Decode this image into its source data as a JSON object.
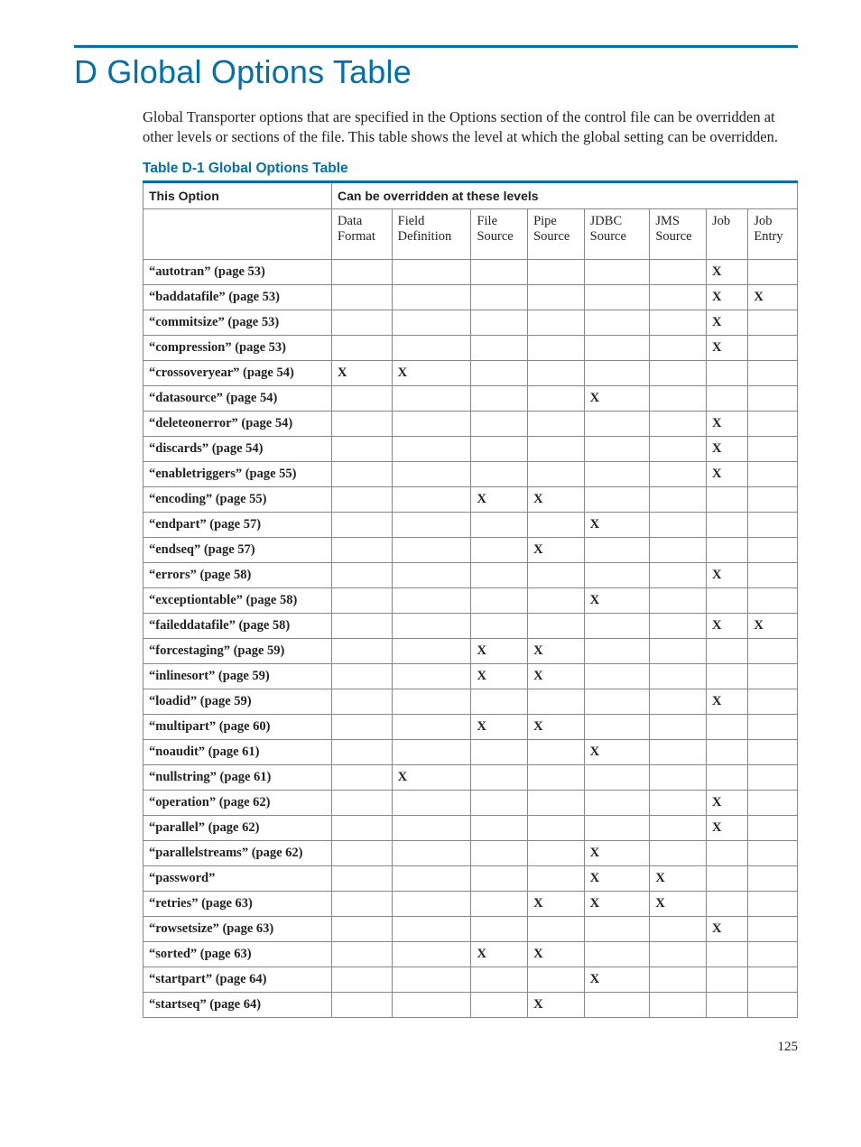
{
  "title": "D Global Options Table",
  "intro": "Global Transporter options that are specified in the Options section of the control file can be overridden at other levels or sections of the file. This table shows the level at which the global setting can be overridden.",
  "caption": "Table D-1 Global Options Table",
  "page_number": "125",
  "mark": "X",
  "header": {
    "this_option": "This Option",
    "override": "Can be overridden at these levels",
    "cols": [
      "Data Format",
      "Field Definition",
      "File Source",
      "Pipe Source",
      "JDBC Source",
      "JMS Source",
      "Job",
      "Job Entry"
    ]
  },
  "rows": [
    {
      "label": "“autotran” (page 53)",
      "marks": [
        "",
        "",
        "",
        "",
        "",
        "",
        "X",
        ""
      ]
    },
    {
      "label": "“baddatafile” (page 53)",
      "marks": [
        "",
        "",
        "",
        "",
        "",
        "",
        "X",
        "X"
      ]
    },
    {
      "label": "“commitsize” (page 53)",
      "marks": [
        "",
        "",
        "",
        "",
        "",
        "",
        "X",
        ""
      ]
    },
    {
      "label": "“compression” (page 53)",
      "marks": [
        "",
        "",
        "",
        "",
        "",
        "",
        "X",
        ""
      ]
    },
    {
      "label": "“crossoveryear” (page 54)",
      "marks": [
        "X",
        "X",
        "",
        "",
        "",
        "",
        "",
        ""
      ]
    },
    {
      "label": "“datasource” (page 54)",
      "marks": [
        "",
        "",
        "",
        "",
        "X",
        "",
        "",
        ""
      ]
    },
    {
      "label": "“deleteonerror” (page 54)",
      "marks": [
        "",
        "",
        "",
        "",
        "",
        "",
        "X",
        ""
      ]
    },
    {
      "label": "“discards” (page 54)",
      "marks": [
        "",
        "",
        "",
        "",
        "",
        "",
        "X",
        ""
      ]
    },
    {
      "label": "“enabletriggers” (page 55)",
      "marks": [
        "",
        "",
        "",
        "",
        "",
        "",
        "X",
        ""
      ]
    },
    {
      "label": "“encoding” (page 55)",
      "marks": [
        "",
        "",
        "X",
        "X",
        "",
        "",
        "",
        ""
      ]
    },
    {
      "label": "“endpart” (page 57)",
      "marks": [
        "",
        "",
        "",
        "",
        "X",
        "",
        "",
        ""
      ]
    },
    {
      "label": "“endseq” (page 57)",
      "marks": [
        "",
        "",
        "",
        "X",
        "",
        "",
        "",
        ""
      ]
    },
    {
      "label": "“errors” (page 58)",
      "marks": [
        "",
        "",
        "",
        "",
        "",
        "",
        "X",
        ""
      ]
    },
    {
      "label": "“exceptiontable” (page 58)",
      "marks": [
        "",
        "",
        "",
        "",
        "X",
        "",
        "",
        ""
      ]
    },
    {
      "label": "“faileddatafile” (page 58)",
      "marks": [
        "",
        "",
        "",
        "",
        "",
        "",
        "X",
        "X"
      ]
    },
    {
      "label": "“forcestaging” (page 59)",
      "marks": [
        "",
        "",
        "X",
        "X",
        "",
        "",
        "",
        ""
      ]
    },
    {
      "label": "“inlinesort” (page 59)",
      "marks": [
        "",
        "",
        "X",
        "X",
        "",
        "",
        "",
        ""
      ]
    },
    {
      "label": "“loadid” (page 59)",
      "marks": [
        "",
        "",
        "",
        "",
        "",
        "",
        "X",
        ""
      ]
    },
    {
      "label": "“multipart” (page 60)",
      "marks": [
        "",
        "",
        "X",
        "X",
        "",
        "",
        "",
        ""
      ]
    },
    {
      "label": "“noaudit” (page 61)",
      "marks": [
        "",
        "",
        "",
        "",
        "X",
        "",
        "",
        ""
      ]
    },
    {
      "label": "“nullstring” (page 61)",
      "marks": [
        "",
        "X",
        "",
        "",
        "",
        "",
        "",
        ""
      ]
    },
    {
      "label": "“operation” (page 62)",
      "marks": [
        "",
        "",
        "",
        "",
        "",
        "",
        "X",
        ""
      ]
    },
    {
      "label": "“parallel” (page 62)",
      "marks": [
        "",
        "",
        "",
        "",
        "",
        "",
        "X",
        ""
      ]
    },
    {
      "label": "“parallelstreams” (page 62)",
      "marks": [
        "",
        "",
        "",
        "",
        "X",
        "",
        "",
        ""
      ]
    },
    {
      "label": "“password”",
      "marks": [
        "",
        "",
        "",
        "",
        "X",
        "X",
        "",
        ""
      ]
    },
    {
      "label": "“retries” (page 63)",
      "marks": [
        "",
        "",
        "",
        "X",
        "X",
        "X",
        "",
        ""
      ]
    },
    {
      "label": "“rowsetsize” (page 63)",
      "marks": [
        "",
        "",
        "",
        "",
        "",
        "",
        "X",
        ""
      ]
    },
    {
      "label": "“sorted” (page 63)",
      "marks": [
        "",
        "",
        "X",
        "X",
        "",
        "",
        "",
        ""
      ]
    },
    {
      "label": "“startpart” (page 64)",
      "marks": [
        "",
        "",
        "",
        "",
        "X",
        "",
        "",
        ""
      ]
    },
    {
      "label": "“startseq” (page 64)",
      "marks": [
        "",
        "",
        "",
        "X",
        "",
        "",
        "",
        ""
      ]
    }
  ]
}
